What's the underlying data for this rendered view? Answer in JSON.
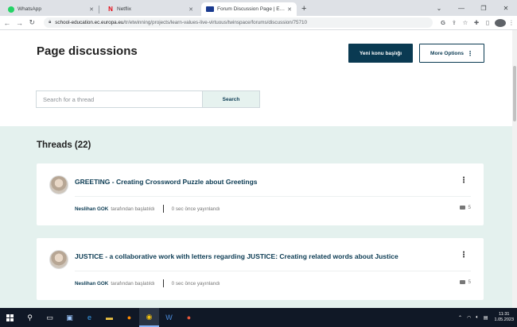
{
  "browser": {
    "tabs": [
      {
        "title": "WhatsApp",
        "icon": "whatsapp-icon",
        "active": false
      },
      {
        "title": "Netflix",
        "icon": "netflix-icon",
        "active": false
      },
      {
        "title": "Forum Discussion Page | ESEP",
        "icon": "eu-flag-icon",
        "active": true
      }
    ],
    "new_tab_label": "+",
    "url_host": "school-education.ec.europa.eu",
    "url_path": "/tr/etwinning/projects/learn-values-live-virtuous/twinspace/forums/discussion/75710",
    "profile_initial": "N"
  },
  "page": {
    "title": "Page discussions",
    "new_topic_label": "Yeni konu başlığı",
    "more_options_label": "More Options",
    "search": {
      "placeholder": "Search for a thread",
      "value": "",
      "button_label": "Search"
    },
    "threads_heading": "Threads (22)",
    "threads": [
      {
        "title": "GREETING - Creating Crossword Puzzle about Greetings",
        "author": "Neslihan GOK",
        "started_by_suffix": "tarafından başlatıldı",
        "posted": "0 sec önce yayınlandı",
        "comments": "5"
      },
      {
        "title": "JUSTICE - a collaborative work with letters regarding JUSTICE: Creating related words about Justice",
        "author": "Neslihan GOK",
        "started_by_suffix": "tarafından başlatıldı",
        "posted": "0 sec önce yayınlandı",
        "comments": "5"
      }
    ]
  },
  "taskbar": {
    "time": "11:31",
    "date": "1.05.2023"
  },
  "colors": {
    "primary": "#0a3a52",
    "threads_bg": "#e4f1ee",
    "search_btn_bg": "#e6f2ef"
  }
}
